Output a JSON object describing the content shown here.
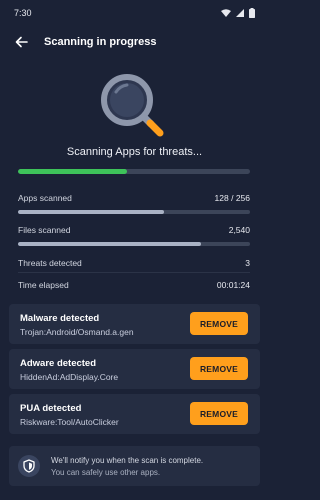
{
  "status_bar": {
    "time": "7:30",
    "icons": [
      "wifi-icon",
      "signal-icon",
      "battery-icon"
    ]
  },
  "header": {
    "title": "Scanning in progress",
    "back_icon": "arrow-left-icon"
  },
  "illustration": {
    "icon": "magnifier-icon",
    "handle_color": "#ff9f1c"
  },
  "scan": {
    "label": "Scanning Apps for threats...",
    "progress": 0.47,
    "progress_color": "#3ec35a"
  },
  "stats": {
    "apps_scanned_label": "Apps scanned",
    "apps_scanned_value": "128 / 256",
    "apps_progress": 0.63,
    "files_scanned_label": "Files scanned",
    "files_scanned_value": "2,540",
    "files_progress": 0.79,
    "threats_label": "Threats detected",
    "threats_value": "3",
    "elapsed_label": "Time elapsed",
    "elapsed_value": "00:01:24"
  },
  "threats": [
    {
      "title": "Malware detected",
      "name": "Trojan:Android/Osmand.a.gen",
      "action": "REMOVE"
    },
    {
      "title": "Adware detected",
      "name": "HiddenAd:AdDisplay.Core",
      "action": "REMOVE"
    },
    {
      "title": "PUA detected",
      "name": "Riskware:Tool/AutoClicker",
      "action": "REMOVE"
    }
  ],
  "info": {
    "icon": "shield-icon",
    "line1": "We'll notify you when the scan is complete.",
    "line2": "You can safely use other apps."
  },
  "colors": {
    "background": "#1b2236",
    "card": "#252d42",
    "accent": "#ff9f1c",
    "progress_green": "#3ec35a"
  }
}
